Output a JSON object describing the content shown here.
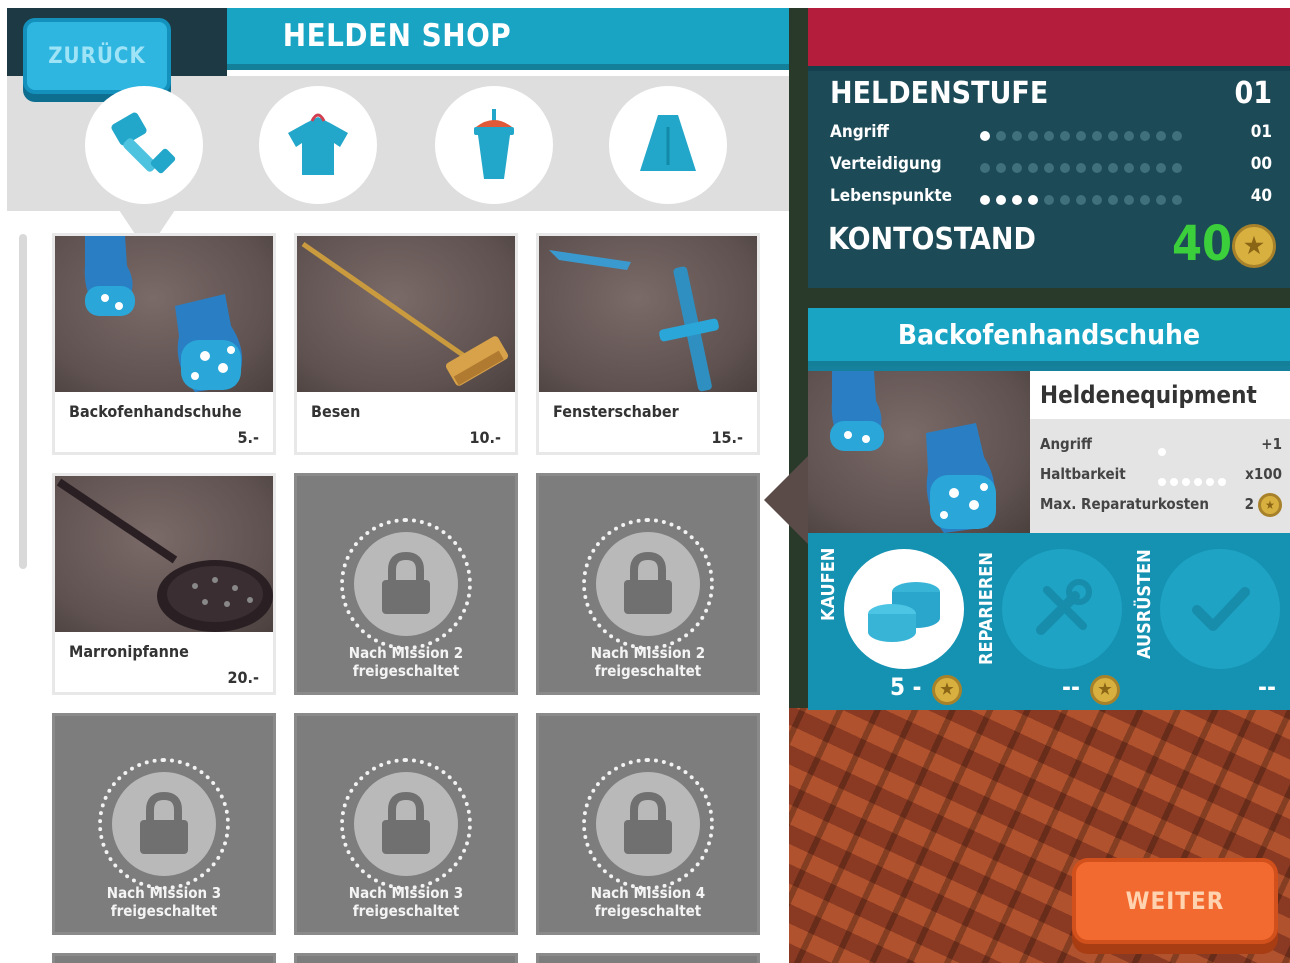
{
  "header": {
    "title": "HELDEN SHOP",
    "back_label": "ZURÜCK"
  },
  "categories": [
    {
      "icon": "hammer-icon",
      "selected": true
    },
    {
      "icon": "shirt-icon",
      "selected": false
    },
    {
      "icon": "drink-cup-icon",
      "selected": false
    },
    {
      "icon": "cape-icon",
      "selected": false
    }
  ],
  "items": [
    {
      "name": "Backofenhandschuhe",
      "price": "5.-",
      "locked": false
    },
    {
      "name": "Besen",
      "price": "10.-",
      "locked": false
    },
    {
      "name": "Fensterschaber",
      "price": "15.-",
      "locked": false
    },
    {
      "name": "Marronipfanne",
      "price": "20.-",
      "locked": false
    },
    {
      "unlock_text": "Nach Mission 2 freigeschaltet",
      "locked": true
    },
    {
      "unlock_text": "Nach Mission 2 freigeschaltet",
      "locked": true
    },
    {
      "unlock_text": "Nach Mission 3 freigeschaltet",
      "locked": true
    },
    {
      "unlock_text": "Nach Mission 3 freigeschaltet",
      "locked": true
    },
    {
      "unlock_text": "Nach Mission 4 freigeschaltet",
      "locked": true
    }
  ],
  "stats": {
    "level_label": "HELDENSTUFE",
    "level_value": "01",
    "rows": [
      {
        "label": "Angriff",
        "filled": 1,
        "total": 13,
        "value": "01"
      },
      {
        "label": "Verteidigung",
        "filled": 0,
        "total": 13,
        "value": "00"
      },
      {
        "label": "Lebenspunkte",
        "filled": 4,
        "total": 13,
        "value": "40"
      }
    ],
    "balance_label": "KONTOSTAND",
    "balance_value": "40"
  },
  "detail": {
    "title": "Backofenhandschuhe",
    "category": "Heldenequipment",
    "rows": [
      {
        "label": "Angriff",
        "value": "+1",
        "dots": 1
      },
      {
        "label": "Haltbarkeit",
        "value": "x100",
        "dots": 6
      },
      {
        "label": "Max. Reparaturkosten",
        "value": "2",
        "dots": 0
      }
    ],
    "actions": {
      "buy_label": "KAUFEN",
      "buy_price": "5 -",
      "repair_label": "REPARIEREN",
      "repair_price": "--",
      "equip_label": "AUSRÜSTEN",
      "equip_price": "--"
    }
  },
  "footer": {
    "continue_label": "WEITER"
  },
  "colors": {
    "teal": "#1aa4c4",
    "dark_teal": "#1d4a57",
    "red": "#b41e3c",
    "orange": "#f26a30",
    "green": "#3bcf3b",
    "coin": "#d8b040"
  }
}
